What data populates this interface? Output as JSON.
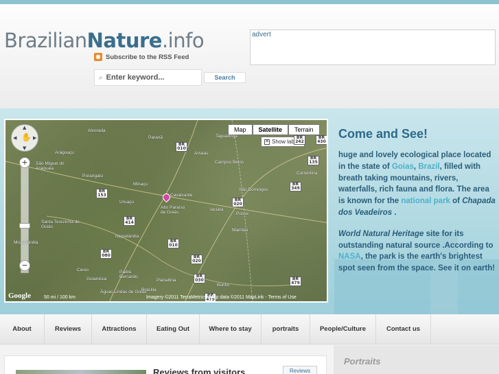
{
  "site": {
    "logo_part1": "Brazilian",
    "logo_part2": "Nature",
    "logo_part3": ".info",
    "rss_text": "Subscribe to the RSS Feed",
    "search_placeholder": "Enter keyword...",
    "search_button": "Search",
    "advert_label": "advert"
  },
  "map": {
    "type_buttons": [
      "Map",
      "Satellite",
      "Terrain"
    ],
    "active_type": "Satellite",
    "show_labels": "Show labels",
    "zoom_in": "+",
    "zoom_out": "−",
    "scale_top": "50 mi",
    "scale_bottom": "100 km",
    "credits": "Imagery ©2011 TerraMetrics, Map data ©2011 MapLink - Terms of Use",
    "google": "Google",
    "place_labels": [
      "Alvorada",
      "Paranã",
      "Taguatinga",
      "Araguaçu",
      "Arraias",
      "Campos Belos",
      "São Miguel do Araguaia",
      "Porangatu",
      "Minaçu",
      "Cavalcante",
      "Correntina",
      "Uruaçu",
      "Alto Paraíso de Goiás",
      "Iaciara",
      "Posse",
      "São Domingos",
      "Santa Terezinha de Goiás",
      "Niquelândia",
      "Mambaí",
      "Mozarlândia",
      "Goianésia",
      "Padre Bernardo",
      "Ceres",
      "Planaltina",
      "Buritis",
      "Águas Lindas de Goiás",
      "Brasília"
    ],
    "road_shields": [
      "BR 010",
      "BR 242",
      "BR 430",
      "BR 135",
      "BR 153",
      "BR 349",
      "BR 020",
      "BR 414",
      "BR 010",
      "BR 080",
      "BR 020",
      "BR 030",
      "BR 479",
      "BR 479"
    ]
  },
  "hero": {
    "heading": "Come and See!",
    "p1_a": "huge and lovely ecological place located in the state of ",
    "p1_link1": "Goias",
    "p1_b": ", ",
    "p1_link2": "Brazil",
    "p1_c": ", filled with breath taking mountains, rivers,  waterfalls, rich fauna and flora. The area is known for the ",
    "p1_link3": "national park",
    "p1_d": " of ",
    "p1_italic": "Chapada dos Veadeiros",
    "p1_e": " .",
    "p2_italic": "World Natural Heritage",
    "p2_a": " site for its outstanding  natural source .According to ",
    "p2_link": "NASA",
    "p2_b": ",   the park is the earth's brightest spot  seen from the space. See it on earth!"
  },
  "nav": {
    "items": [
      "About",
      "Reviews",
      "Attractions",
      "Eating Out",
      "Where to stay",
      "portraits",
      "People/Culture",
      "Contact us"
    ]
  },
  "content": {
    "reviews_title": "Reviews from visitors",
    "reviews_tag": "Reviews",
    "sidebar_title": "Portraits"
  }
}
